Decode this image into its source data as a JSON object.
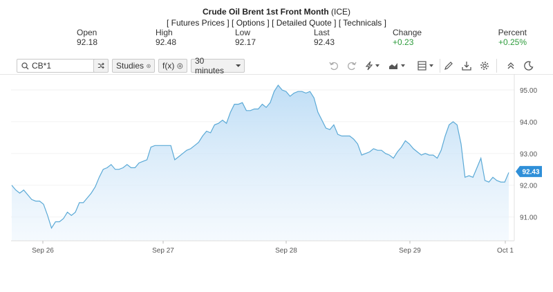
{
  "header": {
    "instrument": "Crude Oil Brent 1st Front Month",
    "exchange": "(ICE)",
    "links": [
      "[ Futures Prices ]",
      "[ Options ]",
      "[ Detailed Quote ]",
      "[ Technicals ]"
    ]
  },
  "stats": {
    "open_label": "Open",
    "open": "92.18",
    "high_label": "High",
    "high": "92.48",
    "low_label": "Low",
    "low": "92.17",
    "last_label": "Last",
    "last": "92.43",
    "change_label": "Change",
    "change": "+0.23",
    "percent_label": "Percent",
    "percent": "+0.25%"
  },
  "toolbar": {
    "symbol": "CB*1",
    "studies_label": "Studies",
    "fx_label": "f(x)",
    "interval_label": "30 minutes",
    "icons": [
      "search-icon",
      "compare-icon",
      "plus-circle-icon",
      "undo-icon",
      "redo-icon",
      "draw-icon",
      "chart-type-icon",
      "layout-icon",
      "pencil-icon",
      "download-icon",
      "settings-icon",
      "collapse-icon",
      "dark-mode-icon"
    ]
  },
  "chart_data": {
    "type": "area",
    "x_ticks": [
      "Sep 26",
      "Sep 27",
      "Sep 28",
      "Sep 29",
      "Oct 1"
    ],
    "y_ticks": [
      "95.00",
      "94.00",
      "93.00",
      "92.00",
      "91.00"
    ],
    "y_tick_values": [
      95,
      94,
      93,
      92,
      91
    ],
    "ylim": [
      90.25,
      95.5
    ],
    "last_value_label": "92.43",
    "last_value": 92.43,
    "line_color": "#5aa9d6",
    "fill_color": "#cfe6f8",
    "label_color": "#2f8fd8",
    "series": [
      {
        "values": [
          92.0,
          91.85,
          91.75,
          91.85,
          91.7,
          91.55,
          91.5,
          91.5,
          91.4,
          91.05,
          90.65,
          90.85,
          90.85,
          90.95,
          91.15,
          91.05,
          91.15,
          91.45,
          91.45,
          91.6,
          91.75,
          91.95,
          92.25,
          92.5,
          92.55,
          92.65,
          92.5,
          92.5,
          92.55,
          92.65,
          92.55,
          92.55,
          92.7,
          92.75,
          92.8,
          93.2,
          93.25,
          93.25,
          93.25,
          93.25,
          93.25,
          92.8,
          92.9,
          93.0,
          93.1,
          93.15,
          93.25,
          93.35,
          93.55,
          93.7,
          93.65,
          93.9,
          93.95,
          94.05,
          93.95,
          94.3,
          94.55,
          94.55,
          94.6,
          94.35,
          94.35,
          94.4,
          94.4,
          94.55,
          94.45,
          94.6,
          94.95,
          95.15,
          95.0,
          94.95,
          94.8,
          94.9,
          94.95,
          94.95,
          94.9,
          94.95,
          94.75,
          94.3,
          94.05,
          93.8,
          93.75,
          93.9,
          93.6,
          93.55,
          93.55,
          93.55,
          93.45,
          93.3,
          92.95,
          93.0,
          93.05,
          93.15,
          93.1,
          93.1,
          93.0,
          92.95,
          92.85,
          93.05,
          93.2,
          93.4,
          93.3,
          93.15,
          93.05,
          92.95,
          93.0,
          92.95,
          92.95,
          92.85,
          93.1,
          93.55,
          93.9,
          94.0,
          93.9,
          93.3,
          92.25,
          92.3,
          92.25,
          92.55,
          92.85,
          92.15,
          92.1,
          92.25,
          92.15,
          92.1,
          92.1,
          92.4
        ]
      }
    ]
  }
}
